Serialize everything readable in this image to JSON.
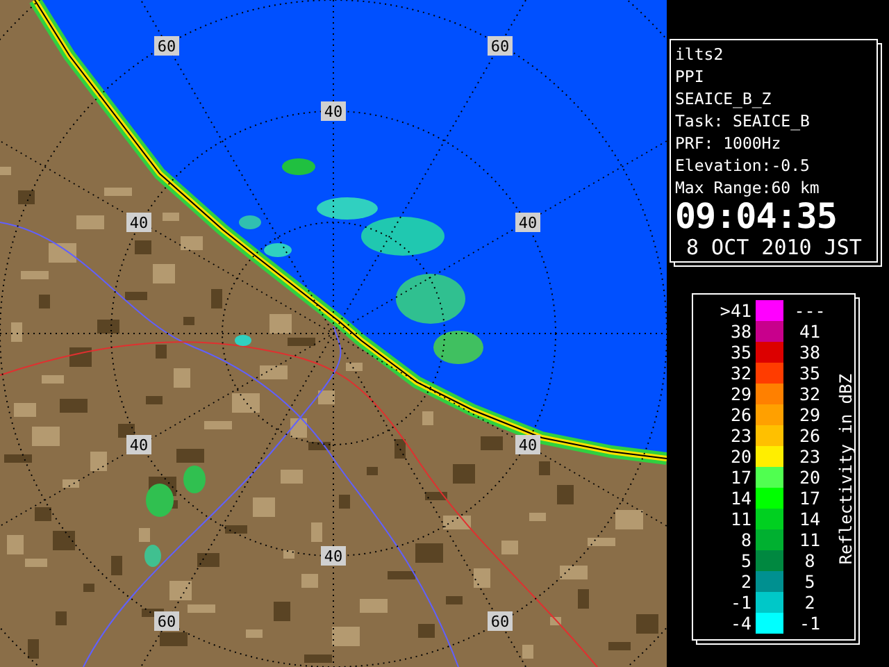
{
  "map": {
    "range_labels": [
      "60",
      "60",
      "40",
      "40",
      "40",
      "40",
      "40",
      "40",
      "60",
      "60"
    ]
  },
  "info": {
    "lines": [
      "ilts2",
      "PPI",
      "SEAICE_B_Z",
      "Task: SEAICE_B",
      "PRF: 1000Hz",
      "Elevation:-0.5",
      "Max Range:60 km"
    ],
    "time": "09:04:35",
    "date": "8 OCT 2010 JST"
  },
  "legend": {
    "title": "Reflectivity in dBZ",
    "rows": [
      {
        "low": ">41",
        "high": "---",
        "color": "#ff00ff"
      },
      {
        "low": "38",
        "high": "41",
        "color": "#c8008c"
      },
      {
        "low": "35",
        "high": "38",
        "color": "#dc0000"
      },
      {
        "low": "32",
        "high": "35",
        "color": "#ff3c00"
      },
      {
        "low": "29",
        "high": "32",
        "color": "#ff8000"
      },
      {
        "low": "26",
        "high": "29",
        "color": "#ffa000"
      },
      {
        "low": "23",
        "high": "26",
        "color": "#ffc000"
      },
      {
        "low": "20",
        "high": "23",
        "color": "#ffee00"
      },
      {
        "low": "17",
        "high": "20",
        "color": "#50ff50"
      },
      {
        "low": "14",
        "high": "17",
        "color": "#00ff00"
      },
      {
        "low": "11",
        "high": "14",
        "color": "#00d020"
      },
      {
        "low": "8",
        "high": "11",
        "color": "#00b030"
      },
      {
        "low": "5",
        "high": "8",
        "color": "#008840"
      },
      {
        "low": "2",
        "high": "5",
        "color": "#009090"
      },
      {
        "low": "-1",
        "high": "2",
        "color": "#00c8c8"
      },
      {
        "low": "-4",
        "high": "-1",
        "color": "#00ffff"
      }
    ]
  }
}
